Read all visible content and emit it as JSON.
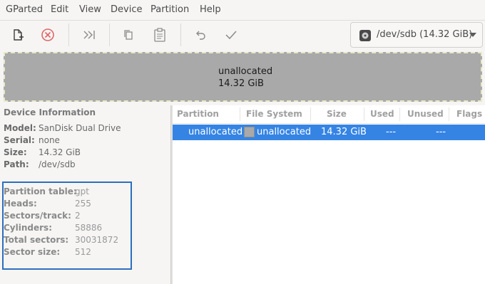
{
  "menu": {
    "items": [
      "GParted",
      "Edit",
      "View",
      "Device",
      "Partition",
      "Help"
    ]
  },
  "toolbar": {
    "buttons": [
      "new-icon",
      "delete-icon",
      "resize-move-icon",
      "copy-icon",
      "paste-icon",
      "undo-icon",
      "apply-icon"
    ],
    "device_selector": "/dev/sdb (14.32 GiB)"
  },
  "visual_map": {
    "label": "unallocated",
    "size": "14.32 GiB"
  },
  "device_info": {
    "title": "Device Information",
    "rows": [
      {
        "key": "Model:",
        "value": "SanDisk Dual Drive"
      },
      {
        "key": "Serial:",
        "value": "none"
      },
      {
        "key": "Size:",
        "value": "14.32 GiB"
      },
      {
        "key": "Path:",
        "value": "/dev/sdb"
      }
    ],
    "geometry": [
      {
        "key": "Partition table:",
        "value": "gpt"
      },
      {
        "key": "Heads:",
        "value": "255"
      },
      {
        "key": "Sectors/track:",
        "value": "2"
      },
      {
        "key": "Cylinders:",
        "value": "58886"
      },
      {
        "key": "Total sectors:",
        "value": "30031872"
      },
      {
        "key": "Sector size:",
        "value": "512"
      }
    ]
  },
  "partition_table": {
    "columns": [
      "Partition",
      "File System",
      "Size",
      "Used",
      "Unused",
      "Flags"
    ],
    "rows": [
      {
        "partition": "unallocated",
        "file_system": "unallocated",
        "size": "14.32 GiB",
        "used": "---",
        "unused": "---",
        "flags": ""
      }
    ]
  },
  "colors": {
    "selection": "#3584e4",
    "unallocated": "#a9a9a9",
    "highlight_box": "#2c6fbf"
  }
}
